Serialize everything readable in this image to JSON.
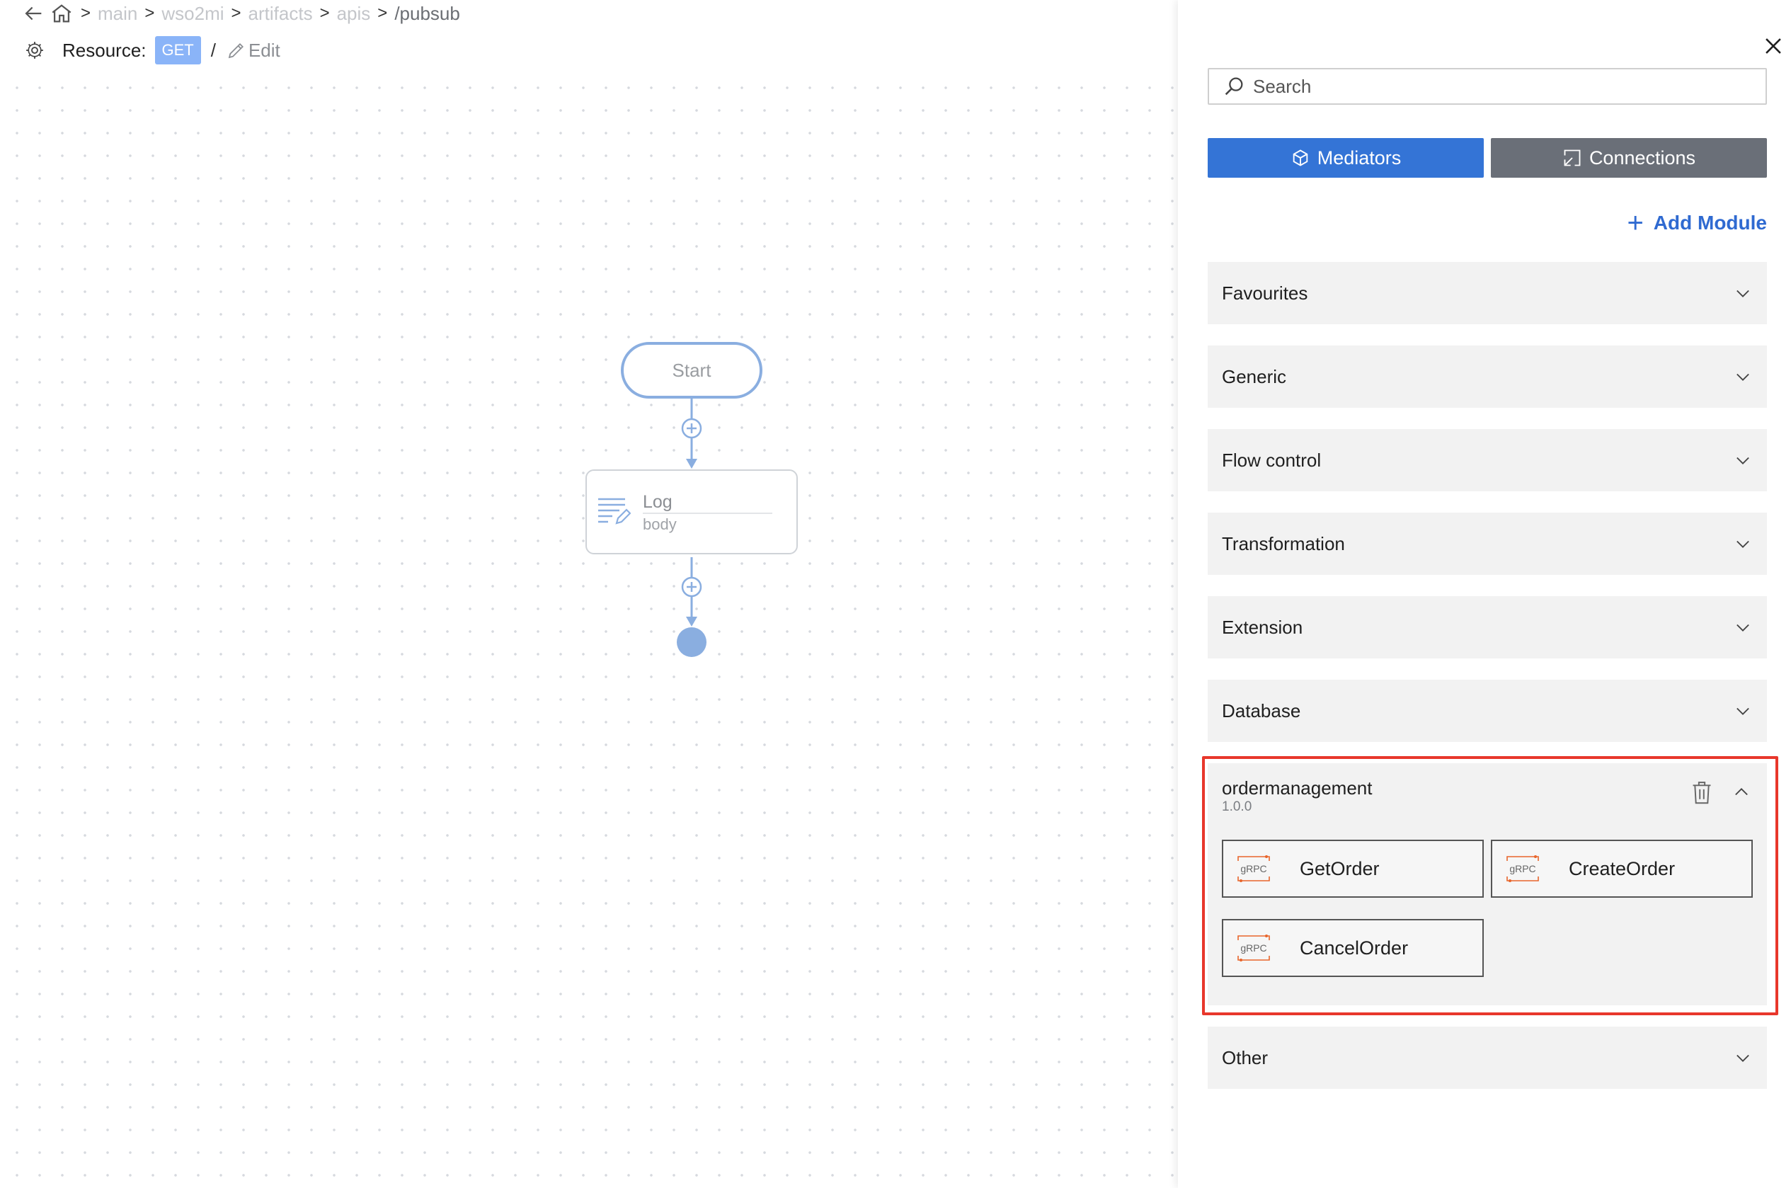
{
  "breadcrumb": {
    "back_icon": "arrow-left-icon",
    "home_icon": "home-icon",
    "items": [
      "main",
      "wso2mi",
      "artifacts",
      "apis"
    ],
    "current": "/pubsub",
    "separator": ">"
  },
  "resource": {
    "label": "Resource:",
    "method": "GET",
    "path": "/",
    "edit_label": "Edit"
  },
  "flow": {
    "start_label": "Start",
    "log_node": {
      "title": "Log",
      "subtitle": "body"
    }
  },
  "panel": {
    "search_placeholder": "Search",
    "tabs": {
      "mediators": "Mediators",
      "connections": "Connections"
    },
    "add_module_label": "Add Module",
    "categories": [
      "Favourites",
      "Generic",
      "Flow control",
      "Transformation",
      "Extension",
      "Database"
    ],
    "module": {
      "name": "ordermanagement",
      "version": "1.0.0",
      "badge": "gRPC",
      "operations": [
        "GetOrder",
        "CreateOrder",
        "CancelOrder"
      ]
    },
    "other_label": "Other"
  },
  "colors": {
    "accent": "#3474d6",
    "secondary_button": "#6a6f78",
    "method_badge": "#8ab4f8",
    "flow_line": "#8aaee0",
    "highlight": "#e8372b",
    "grpc": "#e8652b"
  }
}
